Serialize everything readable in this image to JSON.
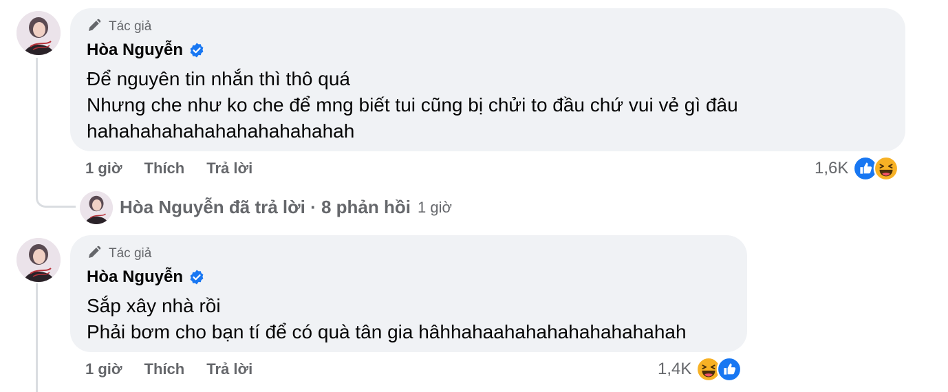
{
  "comments": [
    {
      "badge": "Tác giả",
      "author": "Hòa Nguyễn",
      "lines": [
        "Để nguyên tin nhắn thì thô quá",
        "Nhưng che như ko che để mng biết tui cũng bị chửi to đầu chứ vui vẻ gì đâu",
        "hahahahahahahahahahahahah"
      ],
      "time": "1 giờ",
      "like_label": "Thích",
      "reply_label": "Trả lời",
      "reaction_count": "1,6K",
      "reaction_icons": [
        "like-icon",
        "haha-icon"
      ]
    },
    {
      "badge": "Tác giả",
      "author": "Hòa Nguyễn",
      "lines": [
        "Sắp xây nhà rồi",
        "Phải bơm cho bạn tí để có quà tân gia hâhhahaahahahahahahahahah"
      ],
      "time": "1 giờ",
      "like_label": "Thích",
      "reply_label": "Trả lời",
      "reaction_count": "1,4K",
      "reaction_icons": [
        "haha-icon",
        "like-icon"
      ]
    }
  ],
  "reply_summary": {
    "text": "Hòa Nguyễn đã trả lời · 8 phản hồi",
    "time": "1 giờ"
  },
  "colors": {
    "bubble": "#f0f2f5",
    "meta_text": "#65676b",
    "verified": "#1877f2",
    "like": "#1877f2",
    "haha": "#f7b125"
  }
}
